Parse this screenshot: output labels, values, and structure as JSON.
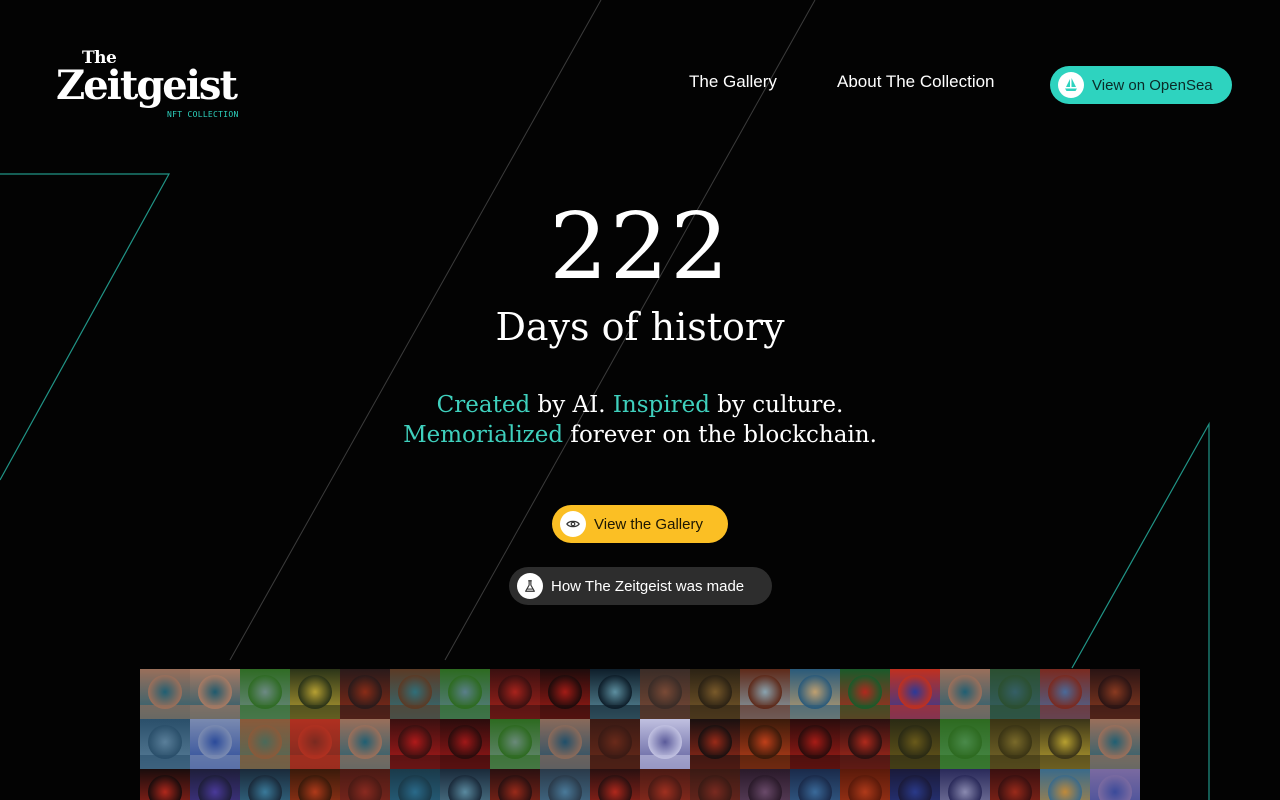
{
  "header": {
    "logo": {
      "the": "The",
      "main": "Zeitgeist",
      "sub": "NFT COLLECTION"
    },
    "nav": [
      {
        "label": "The Gallery"
      },
      {
        "label": "About The Collection"
      }
    ],
    "opensea_button": {
      "label": "View on OpenSea",
      "icon": "sailboat-icon"
    }
  },
  "hero": {
    "number": "222",
    "subtitle": "Days of history",
    "tagline": {
      "w1": "Created",
      "t1": " by AI. ",
      "w2": "Inspired",
      "t2": " by culture.",
      "w3": "Memorialized",
      "t3": " forever on the blockchain."
    },
    "gallery_button": {
      "label": "View the Gallery",
      "icon": "eye-icon"
    },
    "made_button": {
      "label": "How The Zeitgeist was made",
      "icon": "flask-icon"
    }
  },
  "colors": {
    "background": "#030303",
    "teal": "#2ed3bf",
    "yellow": "#fbbf24",
    "dark_button": "#2d2d2d"
  },
  "mosaic": {
    "tiles": [
      [
        "#1f5f73",
        "#9a6f5a"
      ],
      [
        "#1e5a6e",
        "#a77a63"
      ],
      [
        "#6d8a84",
        "#2f6b24"
      ],
      [
        "#b7a032",
        "#2b3418"
      ],
      [
        "#8a2c17",
        "#2a1a1a"
      ],
      [
        "#2f6f7a",
        "#5b3a25"
      ],
      [
        "#5a7f8a",
        "#2d6a20"
      ],
      [
        "#a8231c",
        "#3a1010"
      ],
      [
        "#a31c16",
        "#1e0b0b"
      ],
      [
        "#5d8fa0",
        "#0e1e2a"
      ],
      [
        "#7a4a36",
        "#3a2c27"
      ],
      [
        "#7a5a2a",
        "#2b2214"
      ],
      [
        "#8aa4b0",
        "#5e2a1a"
      ],
      [
        "#c0a070",
        "#2a5a7a"
      ],
      [
        "#b2281d",
        "#1a5a2a"
      ],
      [
        "#2a3a9a",
        "#c0301f"
      ],
      [
        "#1f5f73",
        "#9a6f5a"
      ],
      [
        "#355f66",
        "#2b4f30"
      ],
      [
        "#4a6a9a",
        "#7a2a20"
      ],
      [
        "#8a3a20",
        "#2a1414"
      ],
      [
        "#5a7f9a",
        "#2a4f6a"
      ],
      [
        "#2a4a9a",
        "#7a8ab0"
      ],
      [
        "#4a6a5a",
        "#8a5a3a"
      ],
      [
        "#7a2a20",
        "#b03020"
      ],
      [
        "#1f5f73",
        "#9a6f5a"
      ],
      [
        "#b01a1a",
        "#3a1010"
      ],
      [
        "#a01818",
        "#2a0c0c"
      ],
      [
        "#6a8a7a",
        "#2d6a20"
      ],
      [
        "#1f4f6a",
        "#8a6a5a"
      ],
      [
        "#6a2a1a",
        "#3a1a14"
      ],
      [
        "#5a5a9a",
        "#c0c0e0"
      ],
      [
        "#9a2a18",
        "#1a1010"
      ],
      [
        "#c0401a",
        "#3a1a0a"
      ],
      [
        "#a81c16",
        "#2a0c0c"
      ],
      [
        "#b02a1c",
        "#2a1010"
      ],
      [
        "#6a5a1a",
        "#2a2a14"
      ],
      [
        "#4a8a4a",
        "#2d6a20"
      ],
      [
        "#7a6a2a",
        "#3a3414"
      ],
      [
        "#b8a030",
        "#3a3418"
      ],
      [
        "#1f5f73",
        "#9a6f5a"
      ],
      [
        "#b0281c",
        "#1a0c0c"
      ],
      [
        "#4a3a9a",
        "#1e1e3a"
      ],
      [
        "#3a7a9a",
        "#1a2a3a"
      ],
      [
        "#b03a1a",
        "#3a1a0a"
      ],
      [
        "#8a2a20",
        "#4a1a14"
      ],
      [
        "#2a6a8a",
        "#1a3a4a"
      ],
      [
        "#5a8aa0",
        "#1a2a3a"
      ],
      [
        "#9a2a1a",
        "#2a1010"
      ],
      [
        "#4a7a9a",
        "#2a3a4a"
      ],
      [
        "#b0281c",
        "#2a1010"
      ],
      [
        "#a03020",
        "#4a1a14"
      ],
      [
        "#7a2a20",
        "#3a1a14"
      ],
      [
        "#6a4a6a",
        "#2a1a2a"
      ],
      [
        "#3a6a9a",
        "#1a2a4a"
      ],
      [
        "#b03a1a",
        "#5a1a0a"
      ],
      [
        "#2a3a8a",
        "#1a1a3a"
      ],
      [
        "#8a8ab0",
        "#2a2a5a"
      ],
      [
        "#9a2a1a",
        "#3a1010"
      ],
      [
        "#c08a3a",
        "#3a6a8a"
      ],
      [
        "#3a4a9a",
        "#7a6aa0"
      ]
    ]
  }
}
